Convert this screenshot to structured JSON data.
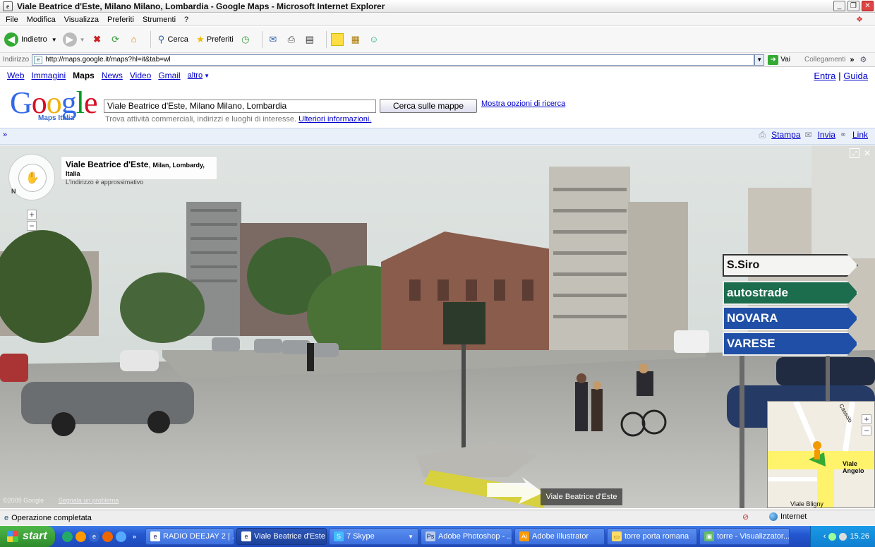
{
  "window": {
    "title": "Viale Beatrice d'Este, Milano Milano, Lombardia - Google Maps - Microsoft Internet Explorer",
    "minimize": "_",
    "restore": "❐",
    "close": "✕"
  },
  "menu": {
    "items": [
      "File",
      "Modifica",
      "Visualizza",
      "Preferiti",
      "Strumenti",
      "?"
    ]
  },
  "toolbar": {
    "back_label": "Indietro",
    "search_label": "Cerca",
    "favorites_label": "Preferiti"
  },
  "address": {
    "label": "Indirizzo",
    "url": "http://maps.google.it/maps?hl=it&tab=wl",
    "go_label": "Vai",
    "links_label": "Collegamenti"
  },
  "google_nav": {
    "items": [
      "Web",
      "Immagini",
      "Maps",
      "News",
      "Video",
      "Gmail",
      "altro"
    ],
    "signin": "Entra",
    "help": "Guida"
  },
  "logo": {
    "text": "Google",
    "subtitle": "Maps Italia"
  },
  "search": {
    "query": "Viale Beatrice d'Este, Milano Milano, Lombardia",
    "button": "Cerca sulle mappe",
    "more_options": "Mostra opzioni di ricerca",
    "hint": "Trova attività commerciali, indirizzi e luoghi di interesse.",
    "hint_link": "Ulteriori informazioni."
  },
  "share": {
    "print": "Stampa",
    "send": "Invia",
    "link": "Link",
    "collapse": "»"
  },
  "streetview": {
    "place_name": "Viale Beatrice d'Este",
    "place_region": "Milan, Lombardy, Italia",
    "approx": "L'indirizzo è approssimativo",
    "copyright": "©2009 Google",
    "report": "Segnala un problema",
    "street_badge": "Viale Beatrice d'Este",
    "signs": [
      "S.Siro",
      "autostrade",
      "NOVARA",
      "VARESE"
    ]
  },
  "minimap": {
    "labels": [
      "Viale Angelo",
      "Viale Bligny",
      "Cassolo"
    ]
  },
  "status": {
    "text": "Operazione completata",
    "zone": "Internet"
  },
  "taskbar": {
    "start": "start",
    "tasks": [
      {
        "label": "RADIO DEEJAY 2 | ...",
        "icon": "ie-icon"
      },
      {
        "label": "Viale Beatrice d'Este...",
        "icon": "ie-icon",
        "active": true
      },
      {
        "label": "7 Skype",
        "icon": "skype-icon"
      },
      {
        "label": "Adobe Photoshop - ...",
        "icon": "photoshop-icon"
      },
      {
        "label": "Adobe Illustrator",
        "icon": "illustrator-icon"
      },
      {
        "label": "torre porta romana",
        "icon": "folder-icon"
      },
      {
        "label": "torre - Visualizzator...",
        "icon": "image-viewer-icon"
      }
    ],
    "clock": "15.26"
  }
}
